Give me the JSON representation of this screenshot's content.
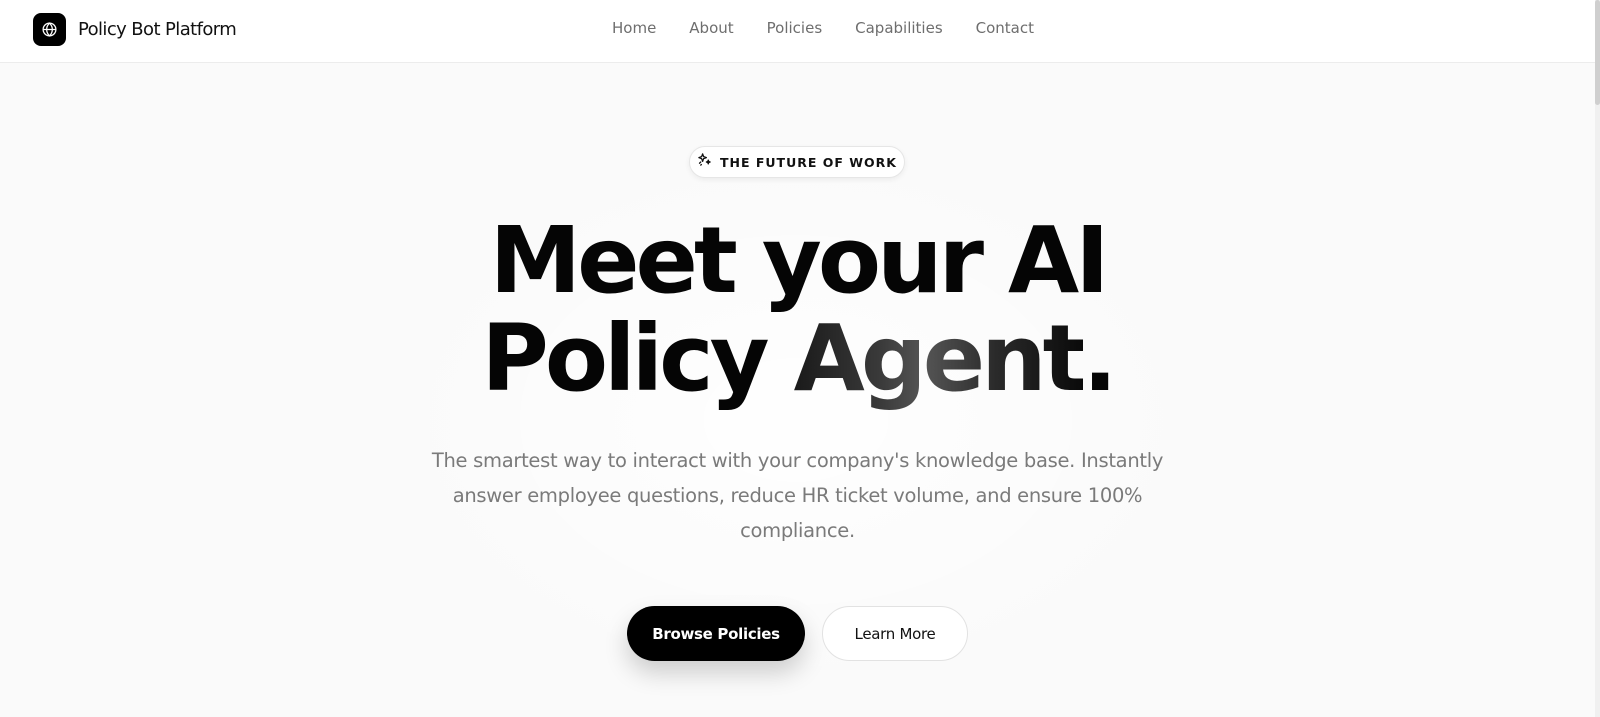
{
  "brand": {
    "name": "Policy Bot Platform",
    "logo_icon": "globe-icon"
  },
  "nav": {
    "items": [
      {
        "label": "Home"
      },
      {
        "label": "About"
      },
      {
        "label": "Policies"
      },
      {
        "label": "Capabilities"
      },
      {
        "label": "Contact"
      }
    ]
  },
  "hero": {
    "badge": {
      "icon": "sparkles-icon",
      "text": "THE FUTURE OF WORK"
    },
    "headline_line1": "Meet your AI",
    "headline_line2_start": "Policy ",
    "headline_line2_accent": "Agent",
    "headline_line2_end": ".",
    "subtitle": "The smartest way to interact with your company's knowledge base. Instantly answer employee questions, reduce HR ticket volume, and ensure 100% compliance.",
    "primary_cta": "Browse Policies",
    "secondary_cta": "Learn More"
  },
  "colors": {
    "background": "#fafafa",
    "primary": "#000000",
    "muted_text": "#7a7a7a"
  }
}
